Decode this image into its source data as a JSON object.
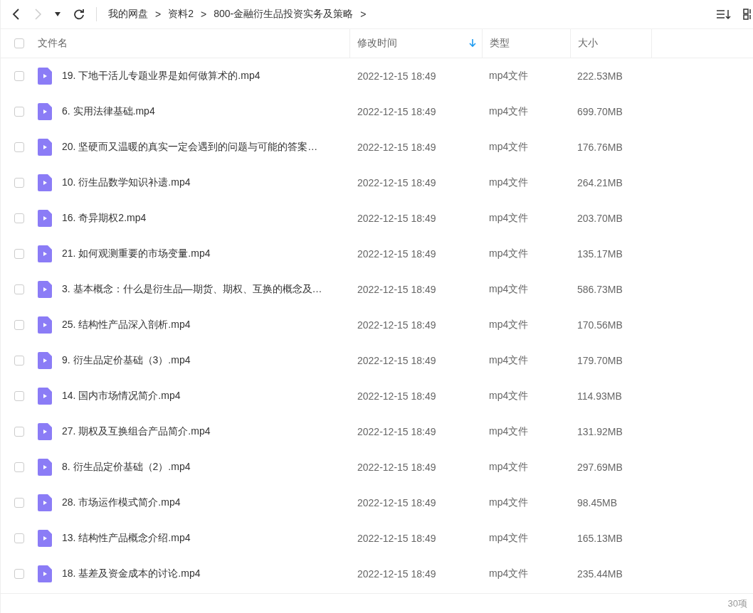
{
  "toolbar": {
    "back_disabled": false,
    "forward_disabled": true,
    "breadcrumb": [
      "我的网盘",
      "资料2",
      "800-金融衍生品投资实务及策略"
    ],
    "separator": ">"
  },
  "table": {
    "columns": [
      {
        "label": "文件名",
        "sorted": false
      },
      {
        "label": "修改时间",
        "sorted": true
      },
      {
        "label": "类型",
        "sorted": false
      },
      {
        "label": "大小",
        "sorted": false
      }
    ],
    "all_selected": false,
    "rows": [
      {
        "name": "19. 下地干活儿专题业界是如何做算术的.mp4",
        "modified": "2022-12-15 18:49",
        "type": "mp4文件",
        "size": "222.53MB",
        "selected": false
      },
      {
        "name": "6. 实用法律基础.mp4",
        "modified": "2022-12-15 18:49",
        "type": "mp4文件",
        "size": "699.70MB",
        "selected": false
      },
      {
        "name": "20. 坚硬而又温暖的真实一定会遇到的问题与可能的答案…",
        "modified": "2022-12-15 18:49",
        "type": "mp4文件",
        "size": "176.76MB",
        "selected": false
      },
      {
        "name": "10. 衍生品数学知识补遗.mp4",
        "modified": "2022-12-15 18:49",
        "type": "mp4文件",
        "size": "264.21MB",
        "selected": false
      },
      {
        "name": "16. 奇异期权2.mp4",
        "modified": "2022-12-15 18:49",
        "type": "mp4文件",
        "size": "203.70MB",
        "selected": false
      },
      {
        "name": "21. 如何观测重要的市场变量.mp4",
        "modified": "2022-12-15 18:49",
        "type": "mp4文件",
        "size": "135.17MB",
        "selected": false
      },
      {
        "name": "3. 基本概念：什么是衍生品—期货、期权、互换的概念及…",
        "modified": "2022-12-15 18:49",
        "type": "mp4文件",
        "size": "586.73MB",
        "selected": false
      },
      {
        "name": "25. 结构性产品深入剖析.mp4",
        "modified": "2022-12-15 18:49",
        "type": "mp4文件",
        "size": "170.56MB",
        "selected": false
      },
      {
        "name": "9. 衍生品定价基础（3）.mp4",
        "modified": "2022-12-15 18:49",
        "type": "mp4文件",
        "size": "179.70MB",
        "selected": false
      },
      {
        "name": "14. 国内市场情况简介.mp4",
        "modified": "2022-12-15 18:49",
        "type": "mp4文件",
        "size": "114.93MB",
        "selected": false
      },
      {
        "name": "27. 期权及互换组合产品简介.mp4",
        "modified": "2022-12-15 18:49",
        "type": "mp4文件",
        "size": "131.92MB",
        "selected": false
      },
      {
        "name": "8. 衍生品定价基础（2）.mp4",
        "modified": "2022-12-15 18:49",
        "type": "mp4文件",
        "size": "297.69MB",
        "selected": false
      },
      {
        "name": "28. 市场运作模式简介.mp4",
        "modified": "2022-12-15 18:49",
        "type": "mp4文件",
        "size": "98.45MB",
        "selected": false
      },
      {
        "name": "13. 结构性产品概念介绍.mp4",
        "modified": "2022-12-15 18:49",
        "type": "mp4文件",
        "size": "165.13MB",
        "selected": false
      },
      {
        "name": "18. 基差及资金成本的讨论.mp4",
        "modified": "2022-12-15 18:49",
        "type": "mp4文件",
        "size": "235.44MB",
        "selected": false
      }
    ]
  },
  "status_bar": {
    "count": "30项"
  }
}
